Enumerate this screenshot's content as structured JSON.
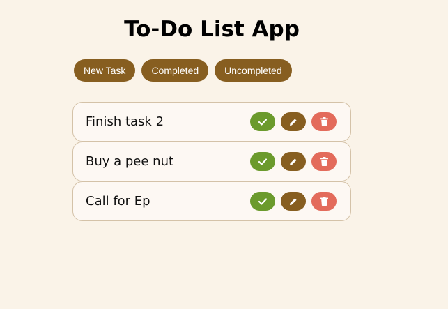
{
  "app": {
    "title": "To-Do List App"
  },
  "filters": [
    {
      "label": "New Task"
    },
    {
      "label": "Completed"
    },
    {
      "label": "Uncompleted"
    }
  ],
  "tasks": [
    {
      "text": "Finish task 2"
    },
    {
      "text": "Buy a pee nut"
    },
    {
      "text": "Call for Ep"
    }
  ],
  "task_actions": {
    "complete_icon": "check-icon",
    "edit_icon": "pencil-icon",
    "delete_icon": "trash-icon"
  },
  "colors": {
    "background": "#faf3e8",
    "brand": "#875e20",
    "complete": "#6b9a2c",
    "delete": "#e36b5b"
  }
}
